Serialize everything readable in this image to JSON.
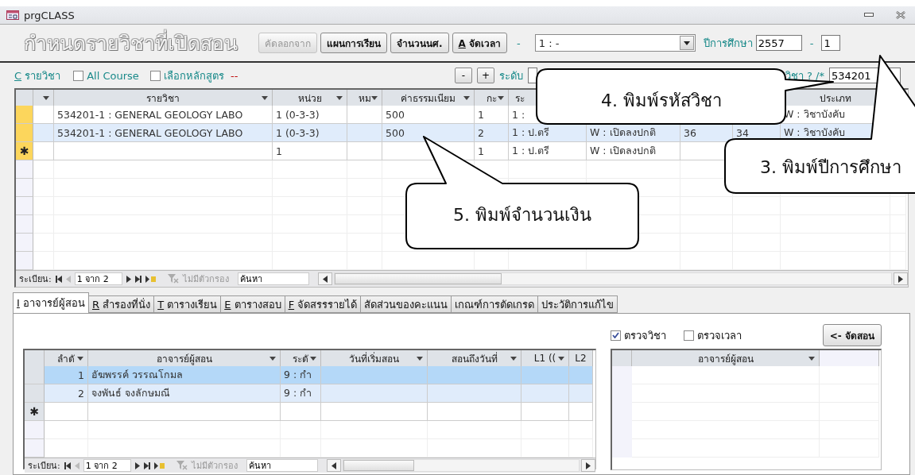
{
  "window": {
    "title": "prgCLASS"
  },
  "header": {
    "title": "กำหนดรายวิชาที่เปิดสอน",
    "buttons": [
      {
        "label": "คัดลอกจาก",
        "disabled": true
      },
      {
        "label": "แผนการเรียน",
        "disabled": false
      },
      {
        "label": "จำนวนนศ.",
        "disabled": false
      },
      {
        "key": "A",
        "label": "จัดเวลา",
        "disabled": false
      }
    ],
    "dash_1": "-",
    "combo": {
      "value": "1 : -"
    },
    "year_label": "ปีการศึกษา",
    "year": "2557",
    "dash_2": "-",
    "term": "1"
  },
  "toolbar": {
    "key": "C",
    "label": "รายวิชา",
    "checkboxes": [
      {
        "label": "All Course",
        "checked": false
      },
      {
        "label": "เลือกหลักสูตร",
        "checked": false
      }
    ],
    "marker": "--",
    "minus": "-",
    "plus": "+",
    "level_label": "ระดับ",
    "code_label": "วิชา ? /*",
    "code": "534201"
  },
  "course_grid": {
    "columns": [
      {
        "kind": "filter"
      },
      {
        "label": "รายวิชา",
        "kind": "filter"
      },
      {
        "label": "หน่วย",
        "kind": "filter"
      },
      {
        "label": "หม",
        "kind": "filter"
      },
      {
        "label": "ค่าธรรมเนียม",
        "kind": "filter"
      },
      {
        "label": "กะ",
        "kind": "filter"
      },
      {
        "label": "ระ",
        "kind": "cut"
      },
      {
        "kind": "covered"
      },
      {
        "kind": "covered"
      },
      {
        "kind": "covered"
      },
      {
        "label": "ประเภท",
        "kind": "plain"
      },
      {
        "kind": "plain"
      }
    ],
    "rows": [
      {
        "kind": "record",
        "selected": false,
        "cells": [
          null,
          "534201-1 : GENERAL GEOLOGY LABO",
          "1 (0-3-3)",
          null,
          "500",
          "1",
          "1 :",
          null,
          null,
          null,
          "W : วิชาบังคับ",
          null
        ]
      },
      {
        "kind": "record",
        "selected": true,
        "cells": [
          null,
          "534201-1 : GENERAL GEOLOGY LABO",
          "1 (0-3-3)",
          null,
          "500",
          "2",
          "1 : ป.ตรี",
          "W : เปิดลงปกติ",
          "36",
          "34",
          "W : วิชาบังคับ",
          null
        ]
      },
      {
        "kind": "new",
        "marker": "✱",
        "selected": false,
        "cells": [
          null,
          null,
          "1",
          null,
          null,
          "1",
          "1 : ป.ตรี",
          "W : เปิดลงปกติ",
          null,
          null,
          null,
          null
        ]
      }
    ],
    "nav": {
      "label": "ระเบียน:",
      "position": "1 จาก 2",
      "filter": "ไม่มีตัวกรอง",
      "search": "ค้นหา"
    }
  },
  "tabs": [
    {
      "key": "I",
      "label": "อาจารย์ผู้สอน",
      "selected": true
    },
    {
      "key": "R",
      "label": "สำรองที่นั่ง",
      "selected": false
    },
    {
      "key": "T",
      "label": "ตารางเรียน",
      "selected": false
    },
    {
      "key": "E",
      "label": "ตารางสอบ",
      "selected": false
    },
    {
      "key": "F",
      "label": "จัดสรรรายได้",
      "selected": false
    },
    {
      "label": "สัดส่วนของคะแนน",
      "selected": false
    },
    {
      "label": "เกณฑ์การตัดเกรด",
      "selected": false
    },
    {
      "label": "ประวัติการแก้ไข",
      "selected": false
    }
  ],
  "teacher_grid": {
    "columns": [
      {
        "label": "ลำดั",
        "kind": "filter"
      },
      {
        "label": "อาจารย์ผู้สอน",
        "kind": "filter"
      },
      {
        "label": "ระดั",
        "kind": "filter"
      },
      {
        "label": "วันที่เริ่มสอน",
        "kind": "filter"
      },
      {
        "label": "สอนถึงวันที่",
        "kind": "filter"
      },
      {
        "label": "L1 ((",
        "kind": "filter"
      },
      {
        "label": "L2",
        "kind": "plain"
      }
    ],
    "rows": [
      {
        "kind": "record",
        "selected": true,
        "current": true,
        "cells": [
          "1",
          "อัฆพรรค์  วรรณโกมล",
          "9 : กำ",
          null,
          null,
          null,
          null
        ]
      },
      {
        "kind": "record",
        "selected": true,
        "current": false,
        "cells": [
          "2",
          "จงพันธ์  จงลักษมณี",
          "9 : กำ",
          null,
          null,
          null,
          null
        ]
      },
      {
        "kind": "new",
        "marker": "✱",
        "selected": false,
        "cells": [
          null,
          null,
          null,
          null,
          null,
          null,
          null
        ]
      }
    ],
    "nav": {
      "label": "ระเบียน:",
      "position": "1 จาก 2",
      "filter": "ไม่มีตัวกรอง",
      "search": "ค้นหา"
    }
  },
  "checks": [
    {
      "label": "ตรวจวิชา",
      "checked": true
    },
    {
      "label": "ตรวจเวลา",
      "checked": false
    }
  ],
  "assign_button": "<- จัดสอน",
  "available_grid": {
    "columns": [
      {
        "label": "อาจารย์ผู้สอน",
        "kind": "filter"
      }
    ]
  },
  "callouts": [
    {
      "text": "4. พิมพ์รหัสวิชา"
    },
    {
      "text": "3. พิมพ์ปีการศึกษา"
    },
    {
      "text": "5. พิมพ์จำนวนเงิน"
    }
  ]
}
